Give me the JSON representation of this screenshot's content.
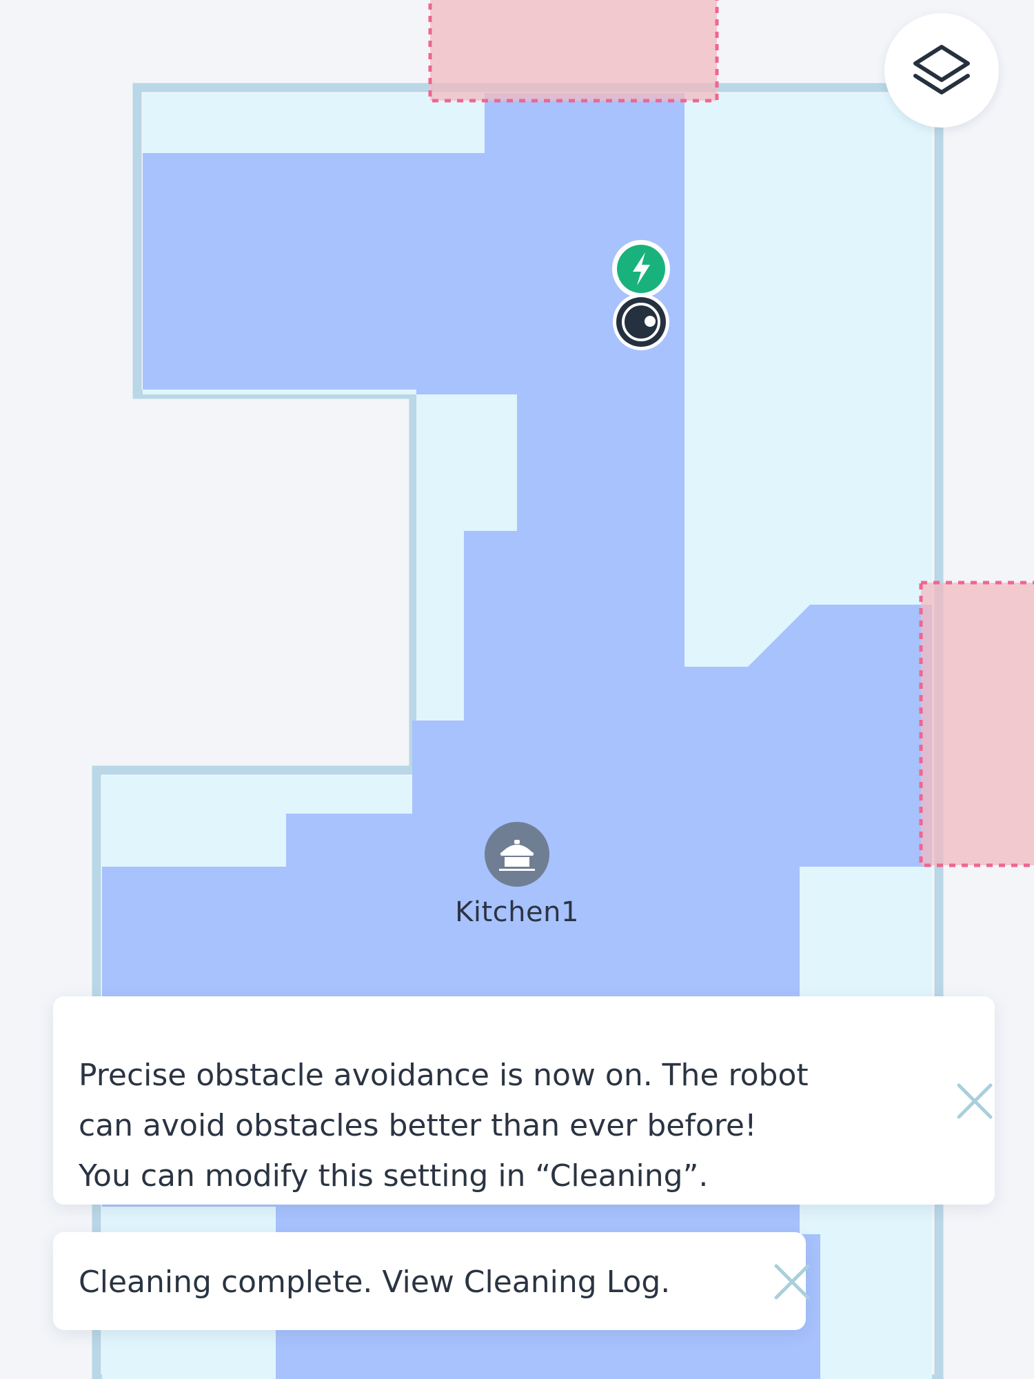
{
  "map": {
    "room_name": "Kitchen1",
    "colors": {
      "background": "#f3f5f9",
      "wall": "#b9d7e6",
      "uncleaned_area": "#e1f5fd",
      "cleaned_area": "#a7c2fd",
      "no_go_zone_fill": "#f6cdd1",
      "no_go_zone_border": "#ef6690",
      "dock": "#19b27d",
      "robot": "#26313f",
      "room_badge": "#6f7e93"
    },
    "icons": {
      "layers": "layers-icon",
      "dock": "lightning-icon",
      "robot": "robot-vacuum-icon",
      "room": "cooking-pot-icon"
    }
  },
  "notifications": [
    {
      "text": "Precise obstacle avoidance is now on. The robot\ncan avoid obstacles better than ever before!\nYou can modify this setting in “Cleaning”.",
      "close_icon": "close-icon"
    },
    {
      "text": "Cleaning complete. View Cleaning Log.",
      "close_icon": "close-icon"
    }
  ]
}
